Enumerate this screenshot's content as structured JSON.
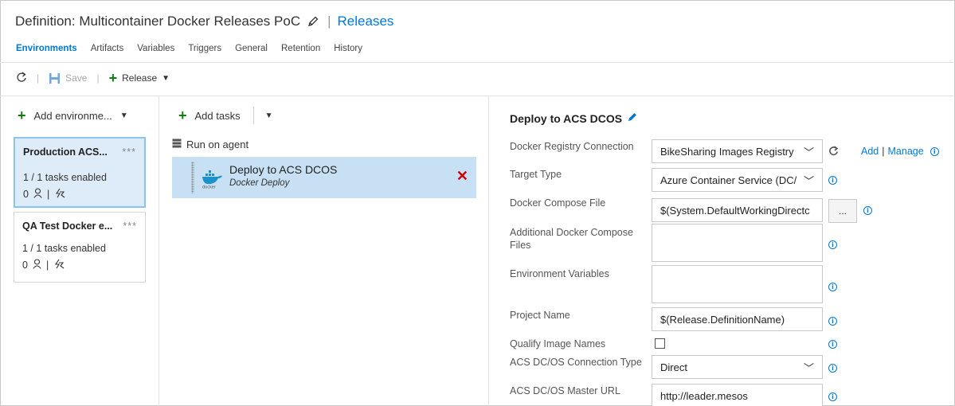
{
  "header": {
    "title": "Definition: Multicontainer Docker Releases PoC",
    "separator": "|",
    "releases_link": "Releases"
  },
  "tabs": [
    {
      "label": "Environments",
      "active": true
    },
    {
      "label": "Artifacts"
    },
    {
      "label": "Variables"
    },
    {
      "label": "Triggers"
    },
    {
      "label": "General"
    },
    {
      "label": "Retention"
    },
    {
      "label": "History"
    }
  ],
  "toolbar": {
    "refresh_icon": "refresh-icon",
    "save_label": "Save",
    "release_label": "Release",
    "separator": "|"
  },
  "environments": {
    "add_label": "Add environme...",
    "items": [
      {
        "name": "Production ACS...",
        "tasks": "1 / 1 tasks enabled",
        "approvers": "0",
        "selected": true
      },
      {
        "name": "QA Test Docker e...",
        "tasks": "1 / 1 tasks enabled",
        "approvers": "0",
        "selected": false
      }
    ],
    "more": "***",
    "icon_sep": "|"
  },
  "tasks": {
    "add_label": "Add tasks",
    "phase_label": "Run on agent",
    "items": [
      {
        "name": "Deploy to ACS DCOS",
        "type": "Docker Deploy",
        "logo_text": "docker"
      }
    ]
  },
  "details": {
    "title": "Deploy to ACS DCOS",
    "fields": {
      "registry_label": "Docker Registry Connection",
      "registry_value": "BikeSharing Images Registry",
      "target_label": "Target Type",
      "target_value": "Azure Container Service (DC/",
      "compose_label": "Docker Compose File",
      "compose_value": "$(System.DefaultWorkingDirectc",
      "browse_label": "...",
      "additional_label": "Additional Docker Compose Files",
      "env_vars_label": "Environment Variables",
      "project_label": "Project Name",
      "project_value": "$(Release.DefinitionName)",
      "qualify_label": "Qualify Image Names",
      "conn_type_label": "ACS DC/OS Connection Type",
      "conn_type_value": "Direct",
      "master_url_label": "ACS DC/OS Master URL",
      "master_url_value": "http://leader.mesos"
    },
    "add_link": "Add",
    "link_sep": "|",
    "manage_link": "Manage"
  },
  "colors": {
    "accent": "#0078d7",
    "selected_bg": "#deecf9",
    "task_selected_bg": "#c7e0f4",
    "add_green": "#107c10",
    "remove_red": "#cc0000"
  }
}
